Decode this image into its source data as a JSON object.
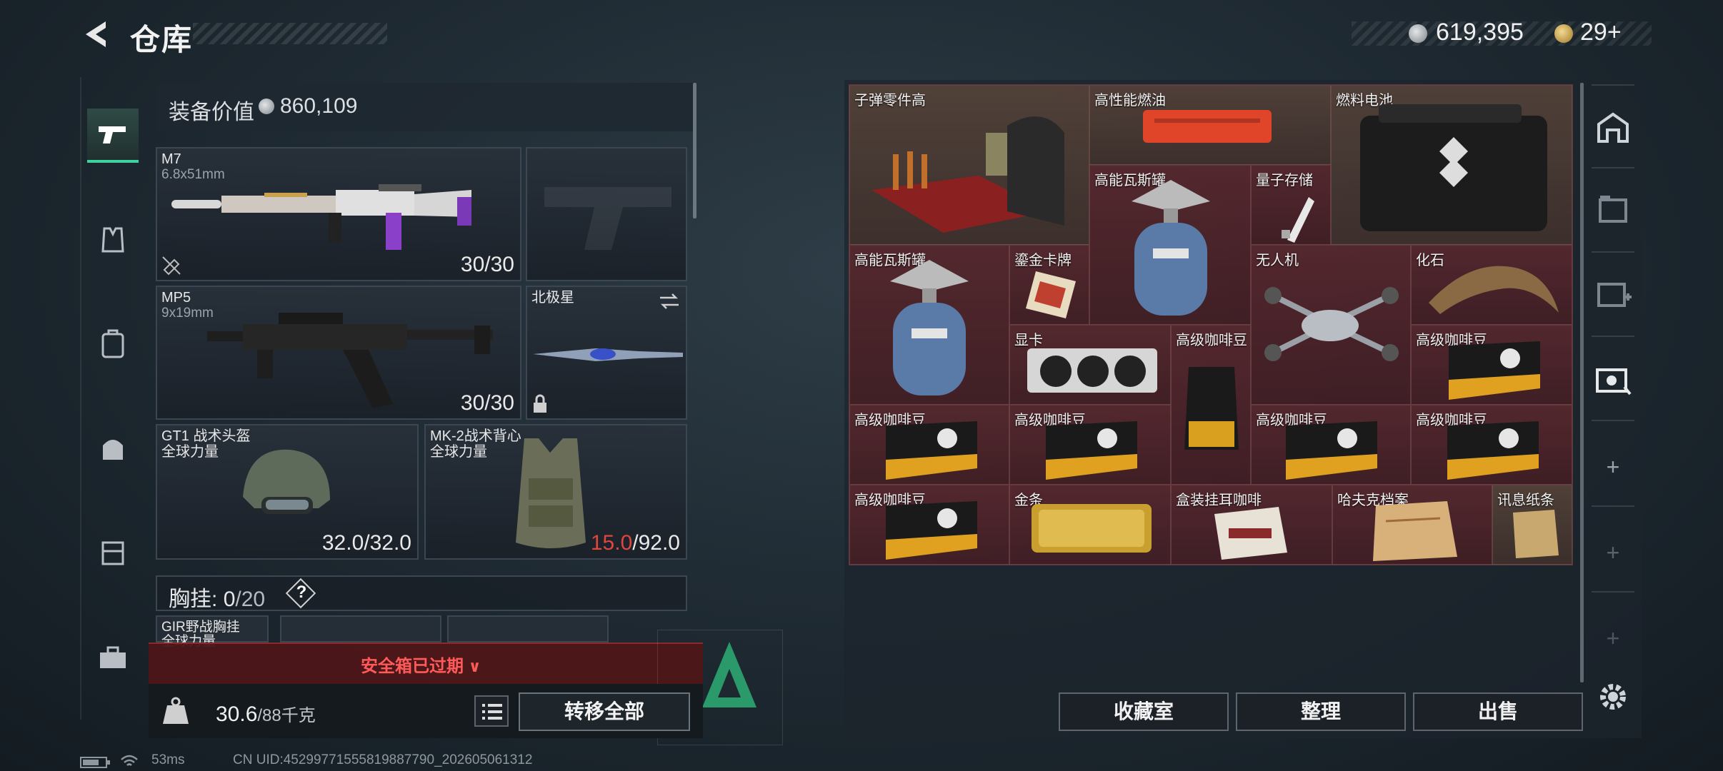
{
  "header": {
    "title": "仓库",
    "currency1": "619,395",
    "currency2": "29+"
  },
  "loadout": {
    "value_label": "装备价值",
    "value": "860,109",
    "primary": {
      "name": "M7",
      "caliber": "6.8x51mm",
      "ammo": "30/30"
    },
    "secondary": {
      "name": "MP5",
      "caliber": "9x19mm",
      "ammo": "30/30"
    },
    "melee": {
      "name": "北极星"
    },
    "helmet": {
      "name": "GT1 战术头盔",
      "brand": "全球力量",
      "durability": "32.0/32.0"
    },
    "armor": {
      "name": "MK-2战术背心",
      "brand": "全球力量",
      "durability_current": "15.0",
      "durability_max": "/92.0"
    },
    "rig": {
      "label": "胸挂:",
      "current": "0",
      "max": "/20",
      "help": "?"
    },
    "rig_item": {
      "name": "GIR野战胸挂",
      "brand": "全球力量"
    },
    "safebox_expired": "安全箱已过期",
    "weight": "30.6",
    "weight_max": "/88千克",
    "transfer_all": "转移全部"
  },
  "stash": {
    "items": [
      {
        "name": "子弹零件高"
      },
      {
        "name": "高性能燃油"
      },
      {
        "name": "燃料电池"
      },
      {
        "name": "高能瓦斯罐"
      },
      {
        "name": "量子存储"
      },
      {
        "name": "高能瓦斯罐"
      },
      {
        "name": "鎏金卡牌"
      },
      {
        "name": "无人机"
      },
      {
        "name": "化石"
      },
      {
        "name": "显卡"
      },
      {
        "name": "高级咖啡豆"
      },
      {
        "name": "高级咖啡豆"
      },
      {
        "name": "高级咖啡豆"
      },
      {
        "name": "高级咖啡豆"
      },
      {
        "name": "高级咖啡豆"
      },
      {
        "name": "高级咖啡豆"
      },
      {
        "name": "高级咖啡豆"
      },
      {
        "name": "金条"
      },
      {
        "name": "盒装挂耳咖啡"
      },
      {
        "name": "哈夫克档案"
      },
      {
        "name": "讯息纸条"
      }
    ],
    "actions": {
      "collection": "收藏室",
      "sort": "整理",
      "sell": "出售"
    }
  },
  "status": {
    "ping": "53ms",
    "uid": "CN UID:45299771555819887790_202605061312"
  }
}
